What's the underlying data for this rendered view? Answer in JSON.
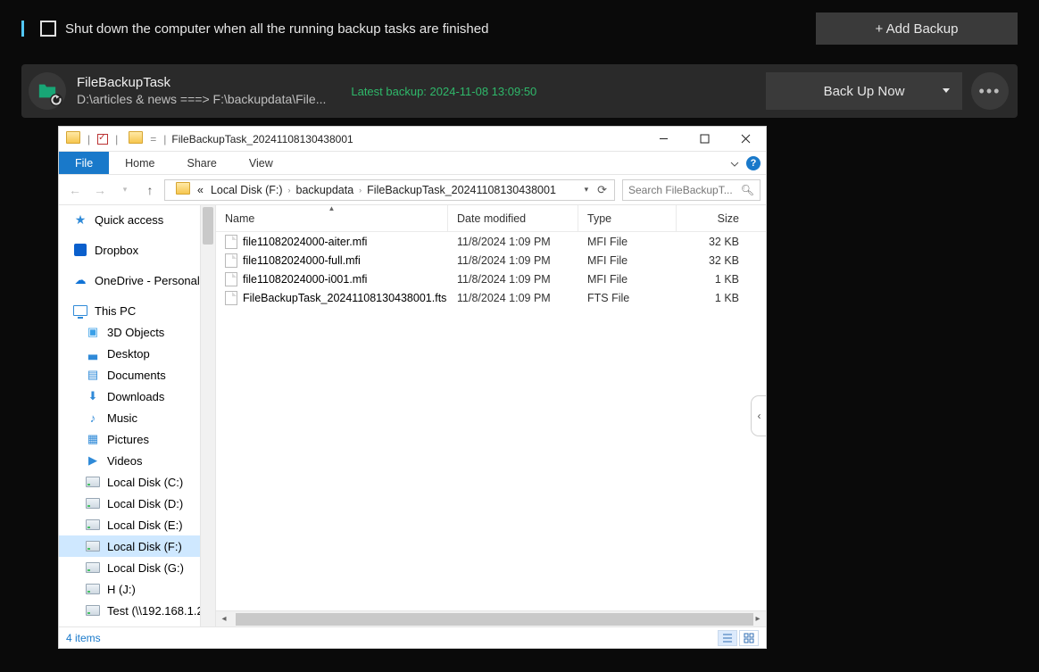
{
  "topbar": {
    "shutdown_label": "Shut down the computer when all the running backup tasks are finished",
    "add_backup": "+ Add Backup"
  },
  "task": {
    "name": "FileBackupTask",
    "path": "D:\\articles & news ===> F:\\backupdata\\File...",
    "latest": "Latest backup: 2024-11-08 13:09:50",
    "backup_now": "Back Up Now"
  },
  "explorer": {
    "title": "FileBackupTask_20241108130438001",
    "tabs": {
      "file": "File",
      "home": "Home",
      "share": "Share",
      "view": "View"
    },
    "breadcrumbs": {
      "pre": "«",
      "b0": "Local Disk (F:)",
      "b1": "backupdata",
      "b2": "FileBackupTask_20241108130438001"
    },
    "search_placeholder": "Search FileBackupT...",
    "nav": {
      "quick": "Quick access",
      "dropbox": "Dropbox",
      "onedrive": "OneDrive - Personal",
      "thispc": "This PC",
      "obj3d": "3D Objects",
      "desktop": "Desktop",
      "documents": "Documents",
      "downloads": "Downloads",
      "music": "Music",
      "pictures": "Pictures",
      "videos": "Videos",
      "dC": "Local Disk (C:)",
      "dD": "Local Disk (D:)",
      "dE": "Local Disk (E:)",
      "dF": "Local Disk (F:)",
      "dG": "Local Disk (G:)",
      "dH": "H (J:)",
      "test": "Test (\\\\192.168.1.2"
    },
    "cols": {
      "name": "Name",
      "date": "Date modified",
      "type": "Type",
      "size": "Size"
    },
    "files": [
      {
        "name": "file11082024000-aiter.mfi",
        "date": "11/8/2024 1:09 PM",
        "type": "MFI File",
        "size": "32 KB"
      },
      {
        "name": "file11082024000-full.mfi",
        "date": "11/8/2024 1:09 PM",
        "type": "MFI File",
        "size": "32 KB"
      },
      {
        "name": "file11082024000-i001.mfi",
        "date": "11/8/2024 1:09 PM",
        "type": "MFI File",
        "size": "1 KB"
      },
      {
        "name": "FileBackupTask_20241108130438001.fts",
        "date": "11/8/2024 1:09 PM",
        "type": "FTS File",
        "size": "1 KB"
      }
    ],
    "status": "4 items"
  }
}
